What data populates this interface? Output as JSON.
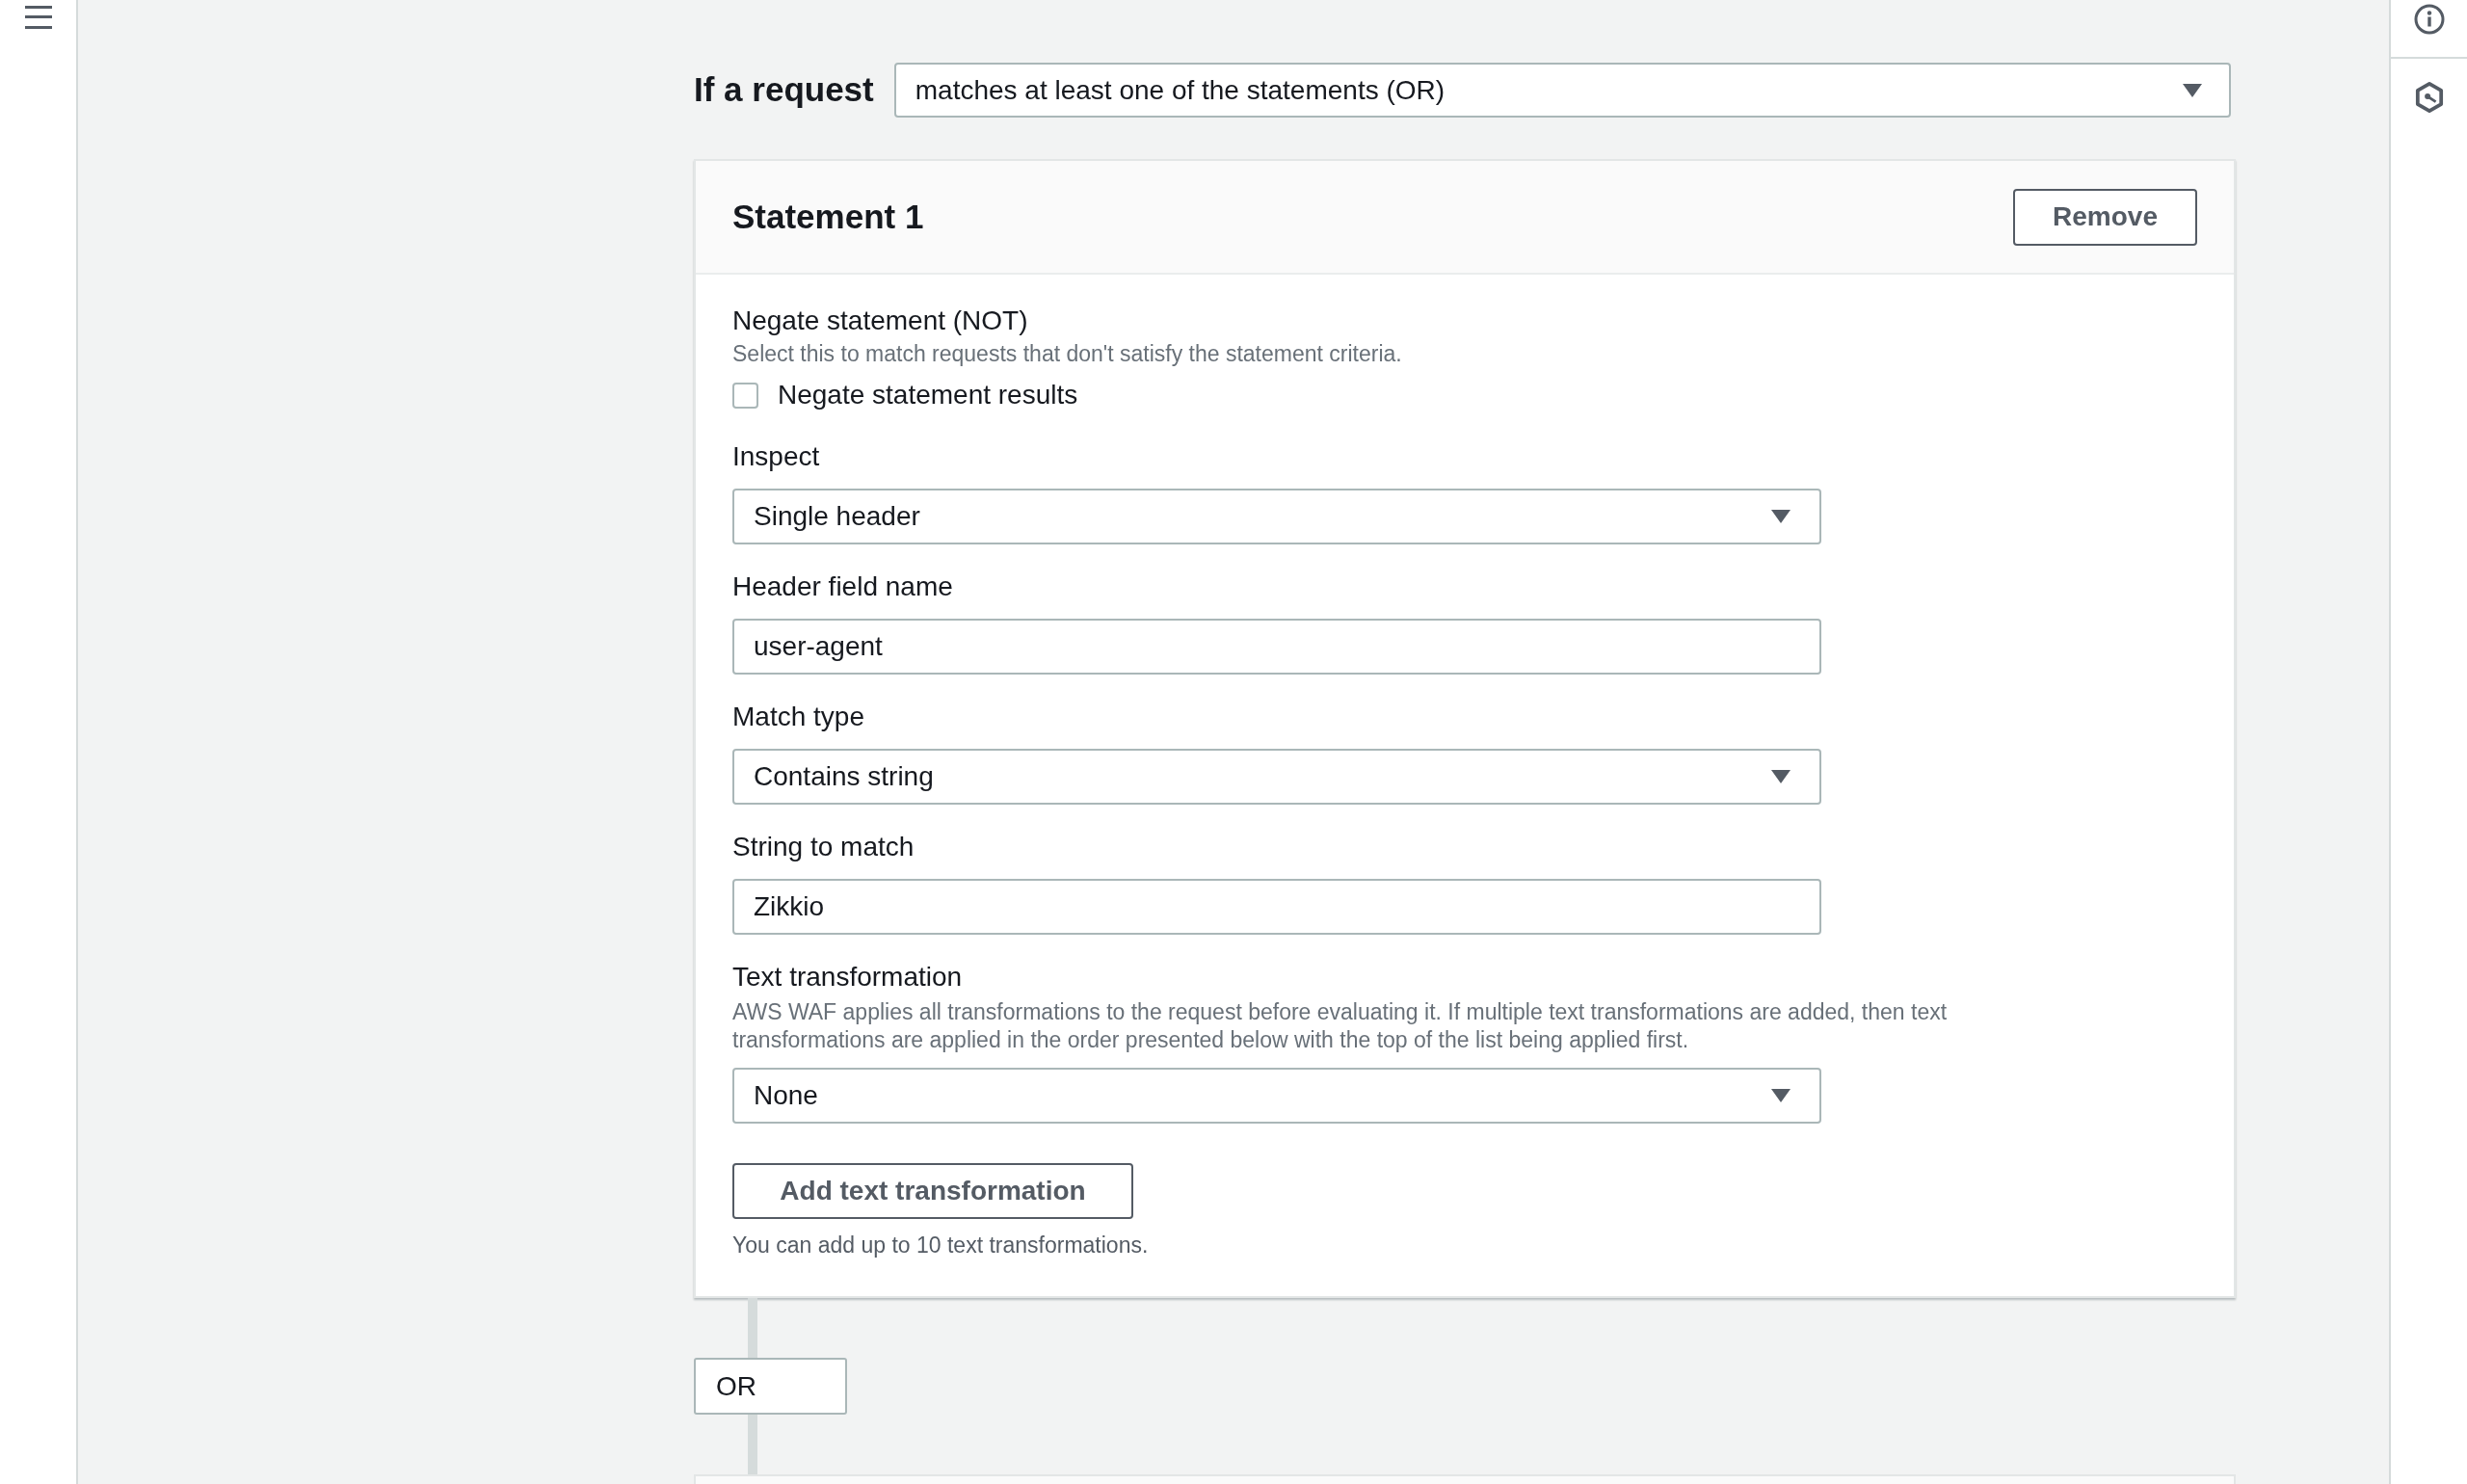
{
  "condition": {
    "label": "If a request",
    "value": "matches at least one of the statements (OR)"
  },
  "statements": [
    {
      "title": "Statement 1",
      "remove_button": "Remove",
      "fields": [
        {
          "kind": "checkbox",
          "label": "Negate statement (NOT)",
          "description": "Select this to match requests that don't satisfy the statement criteria.",
          "option": "Negate statement results",
          "checked": false
        },
        {
          "kind": "select",
          "label": "Inspect",
          "value": "Single header"
        },
        {
          "kind": "input",
          "label": "Header field name",
          "value": "user-agent"
        },
        {
          "kind": "select",
          "label": "Match type",
          "value": "Contains string"
        },
        {
          "kind": "input",
          "label": "String to match",
          "value": "Zikkio"
        },
        {
          "kind": "select",
          "label": "Text transformation",
          "description": "AWS WAF applies all transformations to the request before evaluating it. If multiple text transformations are added, then text transformations are applied in the order presented below with the top of the list being applied first.",
          "value": "None"
        }
      ],
      "add_button": "Add text transformation",
      "hint": "You can add up to 10 text transformations."
    }
  ],
  "operator": "OR"
}
